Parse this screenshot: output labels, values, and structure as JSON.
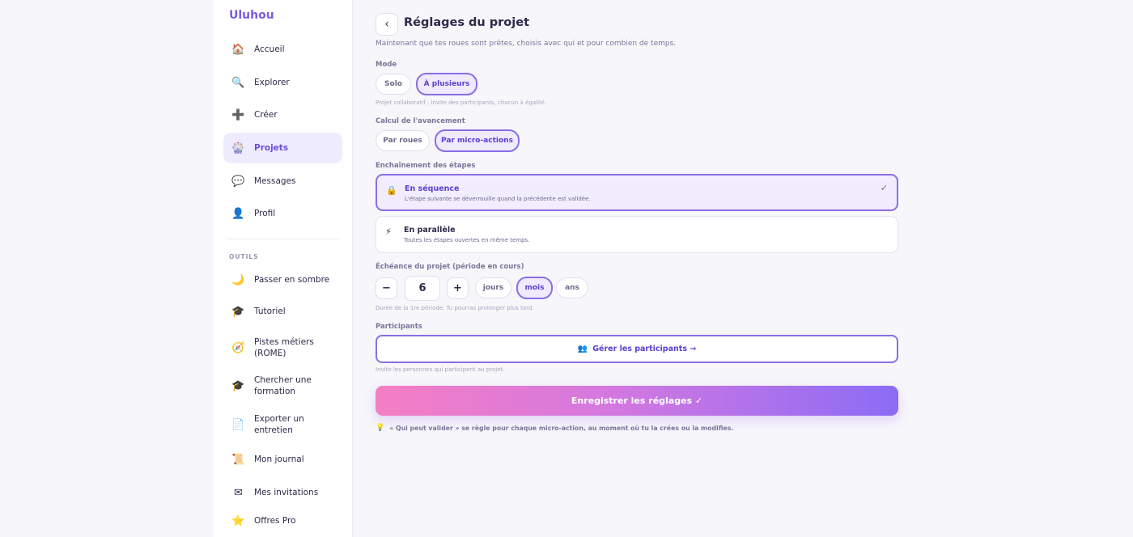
{
  "sidebar": {
    "brand": "Uluhou",
    "items": [
      {
        "label": "Accueil",
        "icon": "🏠",
        "icon_name": "house-icon"
      },
      {
        "label": "Explorer",
        "icon": "🔍",
        "icon_name": "magnifier-icon"
      },
      {
        "label": "Créer",
        "icon": "➕",
        "icon_name": "plus-icon"
      },
      {
        "label": "Projets",
        "icon": "🎡",
        "icon_name": "wheel-icon",
        "active": true
      },
      {
        "label": "Messages",
        "icon": "💬",
        "icon_name": "speech-bubble-icon"
      },
      {
        "label": "Profil",
        "icon": "👤",
        "icon_name": "person-icon"
      }
    ],
    "tools_title": "OUTILS",
    "tools": [
      {
        "label": "Passer en sombre",
        "icon": "🌙",
        "icon_name": "moon-icon"
      },
      {
        "label": "Tutoriel",
        "icon": "🎓",
        "icon_name": "graduation-cap-icon"
      },
      {
        "label": "Pistes métiers (ROME)",
        "icon": "🧭",
        "icon_name": "compass-icon"
      },
      {
        "label": "Chercher une formation",
        "icon": "🎓",
        "icon_name": "graduation-cap-icon"
      },
      {
        "label": "Exporter un entretien",
        "icon": "📄",
        "icon_name": "document-icon"
      },
      {
        "label": "Mon journal",
        "icon": "📜",
        "icon_name": "scroll-icon"
      },
      {
        "label": "Mes invitations",
        "icon": "✉",
        "icon_name": "envelope-icon"
      },
      {
        "label": "Offres Pro",
        "icon": "⭐",
        "icon_name": "star-icon"
      }
    ]
  },
  "header": {
    "back_label": "‹",
    "title": "Réglages du projet",
    "subtitle": "Maintenant que tes roues sont prêtes, choisis avec qui et pour combien de temps."
  },
  "mode": {
    "label": "Mode",
    "options": [
      "Solo",
      "À plusieurs"
    ],
    "selected": "À plusieurs",
    "hint": "Projet collaboratif : invite des participants, chacun à égalité."
  },
  "progress": {
    "label": "Calcul de l'avancement",
    "options": [
      "Par roues",
      "Par micro-actions"
    ],
    "selected": "Par micro-actions"
  },
  "sequence": {
    "label": "Enchaînement des étapes",
    "options": [
      {
        "title": "En séquence",
        "desc": "L'étape suivante se déverrouille quand la précédente est validée.",
        "icon": "🔒",
        "icon_name": "lock-icon",
        "selected": true,
        "check": "✓"
      },
      {
        "title": "En parallèle",
        "desc": "Toutes les étapes ouvertes en même temps.",
        "icon": "⚡",
        "icon_name": "lightning-icon",
        "selected": false
      }
    ]
  },
  "deadline": {
    "label": "Échéance du projet (période en cours)",
    "minus": "−",
    "value": "6",
    "plus": "+",
    "units": [
      "jours",
      "mois",
      "ans"
    ],
    "selected_unit": "mois",
    "hint": "Durée de la 1re période. Tu pourras prolonger plus tard."
  },
  "participants": {
    "label": "Participants",
    "button_icon": "👥",
    "button_icon_name": "people-icon",
    "button": "Gérer les participants →",
    "hint": "Invite les personnes qui participent au projet."
  },
  "save_button": "Enregistrer les réglages ✓",
  "note": {
    "icon": "💡",
    "icon_name": "lightbulb-icon",
    "text": "« Qui peut valider » se règle pour chaque micro-action, au moment où tu la crées ou la modifies."
  },
  "colors": {
    "accent": "#7c5ce0",
    "accent_light": "#efeafe",
    "gradient_start": "#f57ec3",
    "gradient_end": "#8b6cf5"
  }
}
